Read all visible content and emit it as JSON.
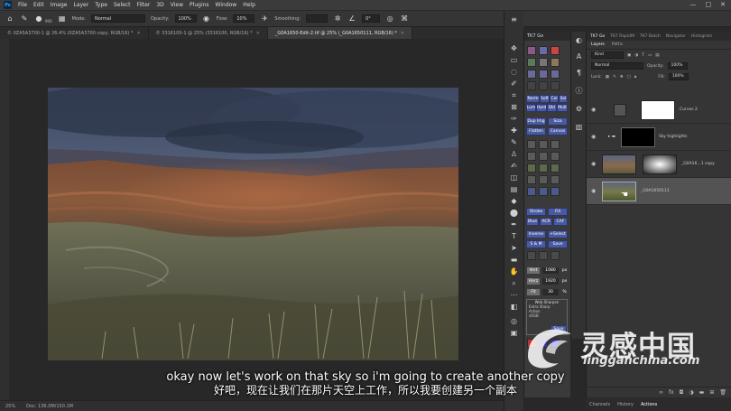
{
  "menubar": {
    "logo": "Ps",
    "items": [
      "File",
      "Edit",
      "Image",
      "Layer",
      "Type",
      "Select",
      "Filter",
      "3D",
      "View",
      "Plugins",
      "Window",
      "Help"
    ],
    "controls": [
      "—",
      "□",
      "✕"
    ]
  },
  "options": {
    "mode_label": "Mode:",
    "mode_value": "Normal",
    "opacity_label": "Opacity:",
    "opacity_value": "100%",
    "flow_label": "Flow:",
    "flow_value": "10%",
    "smoothing_label": "Smoothing:",
    "angle_value": "0°",
    "brush_size": "900"
  },
  "document_tabs": [
    {
      "label": "© 0ZA5A3700-1 @ 26.4% (0ZA5A3700 copy, RGB/16) *",
      "active": false
    },
    {
      "label": "© 3316100-1 @ 25% (3316100, RGB/16) *",
      "active": false
    },
    {
      "label": "_G0A1650-Edit-2.tif @ 25% (_G0A1650111, RGB/16) *",
      "active": true
    }
  ],
  "status": {
    "zoom": "25%",
    "doc": "Doc: 136.0M/150.1M"
  },
  "subtitle": {
    "english": "okay now let's work on that sky so i'm going to create another copy",
    "chinese": "好吧，现在让我们在那片天空上工作，所以我要创建另一个副本"
  },
  "t7_panel": {
    "title": "TK7 Go",
    "buttons": [
      "Norm",
      "Soft",
      "Col",
      "Sol",
      "Lum",
      "Hard",
      "Dkl",
      "Mult",
      "Dup Img",
      "Siza",
      "Flatten",
      "Canvas",
      "Stroke",
      "Fill",
      "Blue",
      "ACR",
      "CAF",
      "Inverse",
      "+Select",
      "S & M",
      "Save",
      "Vert",
      "1080",
      "px",
      "Horz",
      "1920",
      "px",
      "Fit",
      "30",
      "%",
      "Web Sharpen",
      "Extra Sharp",
      "Action",
      "sRGB",
      "Save"
    ]
  },
  "layers_panel": {
    "tabs": [
      "TK7 Go",
      "TK7 RapidM",
      "TK7 Batch",
      "Navigator",
      "Histogram"
    ],
    "subtabs": [
      "Layers",
      "Paths"
    ],
    "filter_label": "Kind",
    "blend_mode": "Normal",
    "opacity_label": "Opacity:",
    "opacity_value": "100%",
    "lock_label": "Lock:",
    "fill_label": "Fill:",
    "fill_value": "100%",
    "layers": [
      {
        "name": "Curves 2",
        "selected": false
      },
      {
        "name": "Sky highlights",
        "selected": false
      },
      {
        "name": "_G0A16...1 copy",
        "selected": false
      },
      {
        "name": "_G0A1650111",
        "selected": true
      }
    ],
    "bottom_icons": [
      "link-icon",
      "fx-icon",
      "mask-icon",
      "adjustment-icon",
      "folder-icon",
      "new-layer-icon",
      "trash-icon"
    ]
  },
  "bottom_tabs": [
    "Channels",
    "History",
    "Actions"
  ],
  "watermark": {
    "chinese": "灵感中国",
    "url": "lingganchina.com"
  }
}
